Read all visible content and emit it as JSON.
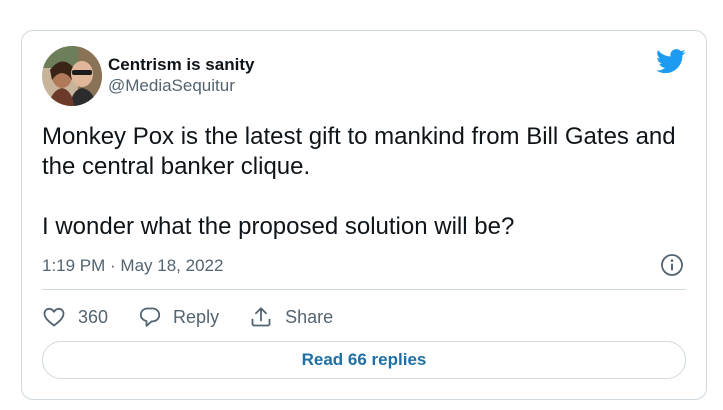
{
  "tweet": {
    "author": {
      "display_name": "Centrism is sanity",
      "handle": "@MediaSequitur",
      "avatar_icon": "avatar-photo"
    },
    "text_lines": [
      "Monkey Pox is the latest gift to mankind from Bill Gates and the central banker clique.",
      "I wonder what the proposed solution will be?"
    ],
    "timestamp": "1:19 PM · May 18, 2022",
    "info_icon": "info-icon",
    "brand_icon": "twitter-bird-icon",
    "actions": {
      "like": {
        "icon": "heart-icon",
        "count": "360"
      },
      "reply": {
        "icon": "reply-bubble-icon",
        "label": "Reply"
      },
      "share": {
        "icon": "share-icon",
        "label": "Share"
      }
    },
    "read_replies_label": "Read 66 replies"
  },
  "colors": {
    "text_primary": "#0f1419",
    "text_secondary": "#536471",
    "border": "#cfd9de",
    "brand_blue": "#1d9bf0",
    "link_blue": "#1d6fa5"
  }
}
